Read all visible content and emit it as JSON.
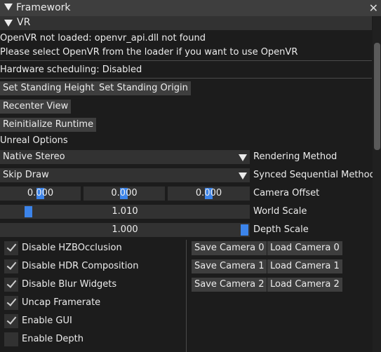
{
  "window": {
    "title": "Framework",
    "close_glyph": "✕"
  },
  "section": {
    "label": "VR"
  },
  "messages": {
    "line1": "OpenVR not loaded: openvr_api.dll not found",
    "line2": "Please select OpenVR from the loader if you want to use OpenVR",
    "hardware": "Hardware scheduling: Disabled"
  },
  "buttons": {
    "set_standing_height": "Set Standing Height",
    "set_standing_origin": "Set Standing Origin",
    "recenter_view": "Recenter View",
    "reinit_runtime": "Reinitialize Runtime"
  },
  "unreal": {
    "heading": "Unreal Options",
    "rendering_method": {
      "value": "Native Stereo",
      "label": "Rendering Method"
    },
    "synced_method": {
      "value": "Skip Draw",
      "label": "Synced Sequential Method"
    },
    "camera_offset": {
      "x": "0.000",
      "y": "0.000",
      "z": "0.000",
      "label": "Camera Offset"
    },
    "world_scale": {
      "value": "1.010",
      "label": "World Scale"
    },
    "depth_scale": {
      "value": "1.000",
      "label": "Depth Scale"
    }
  },
  "checkboxes": [
    {
      "label": "Disable HZBOcclusion",
      "checked": true
    },
    {
      "label": "Disable HDR Composition",
      "checked": true
    },
    {
      "label": "Disable Blur Widgets",
      "checked": true
    },
    {
      "label": "Uncap Framerate",
      "checked": true
    },
    {
      "label": "Enable GUI",
      "checked": true
    },
    {
      "label": "Enable Depth",
      "checked": false
    }
  ],
  "cameras": {
    "save0": "Save Camera 0",
    "load0": "Load Camera 0",
    "save1": "Save Camera 1",
    "load1": "Load Camera 1",
    "save2": "Save Camera 2",
    "load2": "Load Camera 2"
  },
  "colors": {
    "accent": "#3c84ea",
    "window_bg": "#1c1c1c",
    "button": "#3e3e3e",
    "frame": "#323232"
  }
}
